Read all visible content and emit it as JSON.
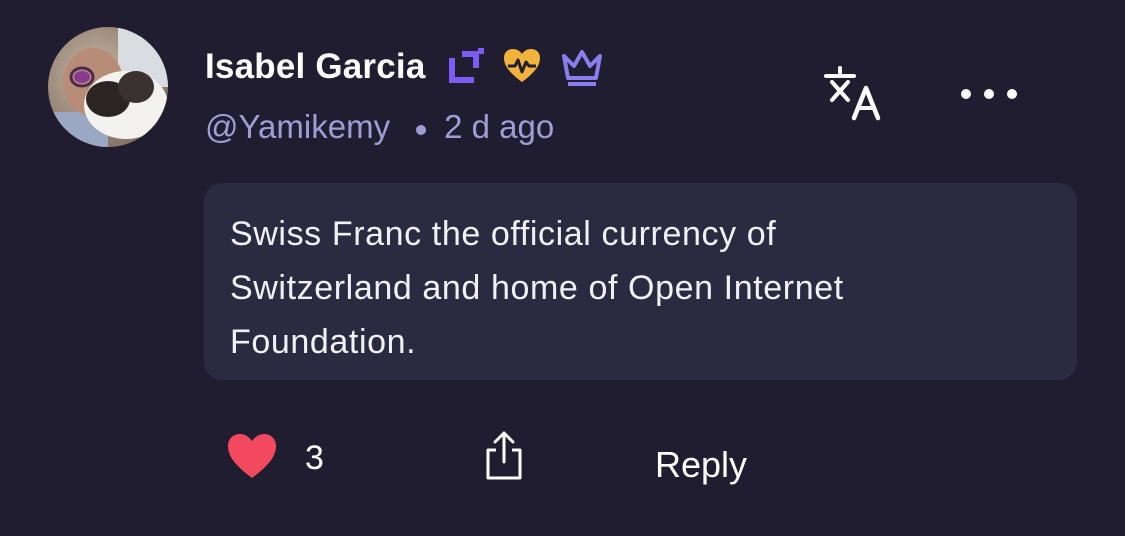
{
  "comment": {
    "author_name": "Isabel Garcia",
    "handle": "@Yamikemy",
    "timestamp": "2 d ago",
    "text": "Swiss Franc the official currency of\nSwitzerland and home of Open Internet\nFoundation.",
    "badges": [
      {
        "icon": "square-bracket-badge-icon",
        "color": "#7c5cf5"
      },
      {
        "icon": "heart-pulse-badge-icon",
        "color": "#f2b33d"
      },
      {
        "icon": "crown-badge-icon",
        "color": "#8c7cf0"
      }
    ]
  },
  "actions": {
    "like_count": "3",
    "reply_label": "Reply",
    "translate_icon": "translate-icon",
    "more_icon": "more-options-icon",
    "like_icon": "heart-icon",
    "share_icon": "share-icon"
  },
  "colors": {
    "background": "#1f1d2f",
    "bubble": "#2c2a40",
    "secondary_text": "#a39bd6",
    "like": "#f2495e"
  }
}
